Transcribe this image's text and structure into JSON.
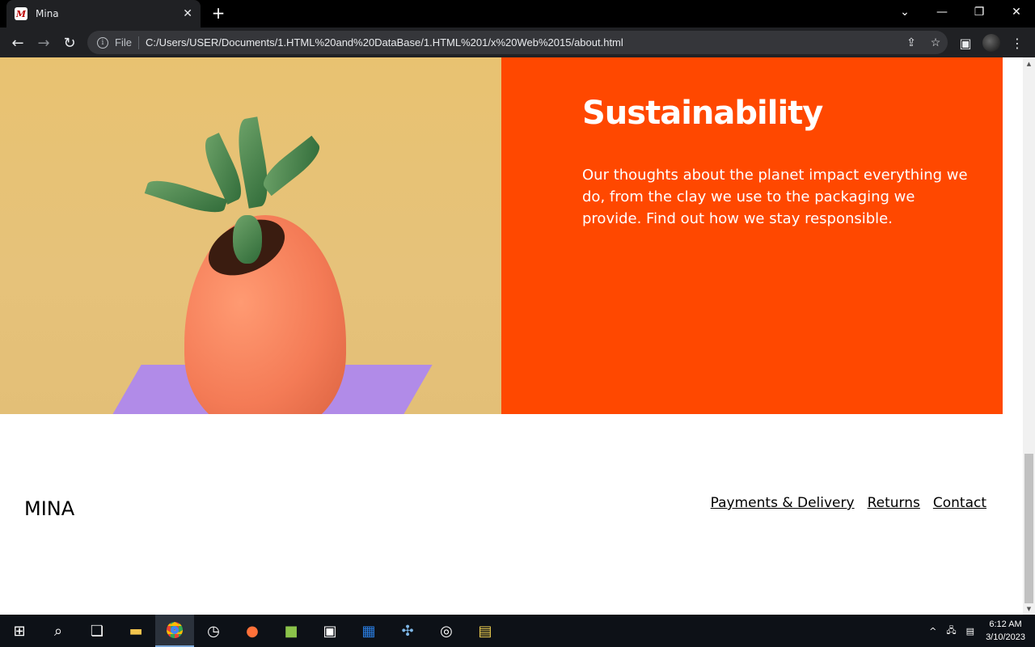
{
  "browser": {
    "tab_title": "Mina",
    "favicon_letter": "M",
    "omnibox_label": "File",
    "url": "C:/Users/USER/Documents/1.HTML%20and%20DataBase/1.HTML%201/x%20Web%2015/about.html"
  },
  "hero": {
    "heading": "Sustainability",
    "body": "Our thoughts about the planet impact everything we do, from the clay we use to the packaging we provide. Find out how we stay responsible.",
    "panel_color": "#ff4800"
  },
  "footer": {
    "logo": "MINA",
    "links": [
      "Payments & Delivery",
      "Returns",
      "Contact"
    ]
  },
  "taskbar": {
    "time": "6:12 AM",
    "date": "3/10/2023"
  }
}
